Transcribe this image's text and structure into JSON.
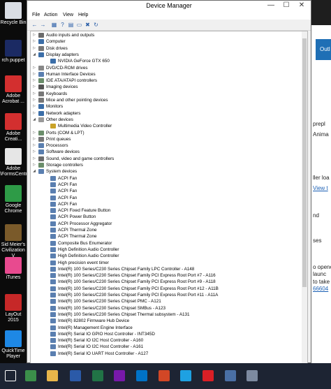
{
  "desktop": {
    "icons": [
      {
        "label": "Recycle Bin",
        "color": "#d9dde4"
      },
      {
        "label": "rch puppet",
        "color": "#1b2a63"
      },
      {
        "label": "Adobe Acrobat ...",
        "color": "#d32f2f"
      },
      {
        "label": "Adobe Creati...",
        "color": "#d32f2f"
      },
      {
        "label": "Adobe \\FormsCentral",
        "color": "#e6e6e6"
      },
      {
        "label": "Google Chrome",
        "color": "#2e9b47"
      },
      {
        "label": "Sid Meier's Civilization V",
        "color": "#7a5a2a"
      },
      {
        "label": "iTunes",
        "color": "#e84a8f"
      },
      {
        "label": "LayOut 2015",
        "color": "#c62828"
      },
      {
        "label": "QuickTime Player",
        "color": "#1e88e5"
      }
    ]
  },
  "background_window": {
    "text": [
      "Outl",
      "prepl",
      "Anima",
      "ller loa",
      "View t",
      "nd",
      "ses",
      "o opene",
      "launc",
      "to take",
      "66604"
    ]
  },
  "window": {
    "title": "Device Manager",
    "controls": {
      "minimize": "—",
      "maximize": "☐",
      "close": "✕"
    },
    "menu": [
      "File",
      "Action",
      "View",
      "Help"
    ],
    "toolbar_icons": [
      "back-icon",
      "forward-icon",
      "properties-icon",
      "help-icon",
      "driver-icon",
      "monitor-icon",
      "uninstall-icon",
      "scan-icon"
    ],
    "tree": [
      {
        "label": "Audio inputs and outputs",
        "level": 0,
        "expanded": false,
        "icon_color": "#6b6b6b"
      },
      {
        "label": "Computer",
        "level": 0,
        "expanded": false,
        "icon_color": "#3b6ea8"
      },
      {
        "label": "Disk drives",
        "level": 0,
        "expanded": false,
        "icon_color": "#777777"
      },
      {
        "label": "Display adapters",
        "level": 0,
        "expanded": true,
        "icon_color": "#3b6ea8"
      },
      {
        "label": "NVIDIA GeForce GTX 650",
        "level": 1,
        "expanded": null,
        "icon_color": "#3b6ea8"
      },
      {
        "label": "DVD/CD-ROM drives",
        "level": 0,
        "expanded": false,
        "icon_color": "#888888"
      },
      {
        "label": "Human Interface Devices",
        "level": 0,
        "expanded": false,
        "icon_color": "#5a7fb0"
      },
      {
        "label": "IDE ATA/ATAPI controllers",
        "level": 0,
        "expanded": false,
        "icon_color": "#6b8e6b"
      },
      {
        "label": "Imaging devices",
        "level": 0,
        "expanded": false,
        "icon_color": "#555555"
      },
      {
        "label": "Keyboards",
        "level": 0,
        "expanded": false,
        "icon_color": "#777777"
      },
      {
        "label": "Mice and other pointing devices",
        "level": 0,
        "expanded": false,
        "icon_color": "#777777"
      },
      {
        "label": "Monitors",
        "level": 0,
        "expanded": false,
        "icon_color": "#3b6ea8"
      },
      {
        "label": "Network adapters",
        "level": 0,
        "expanded": false,
        "icon_color": "#3b6ea8"
      },
      {
        "label": "Other devices",
        "level": 0,
        "expanded": true,
        "icon_color": "#999999"
      },
      {
        "label": "Multimedia Video Controller",
        "level": 1,
        "expanded": null,
        "icon_color": "#c9a227"
      },
      {
        "label": "Ports (COM & LPT)",
        "level": 0,
        "expanded": false,
        "icon_color": "#6b8e6b"
      },
      {
        "label": "Print queues",
        "level": 0,
        "expanded": false,
        "icon_color": "#777777"
      },
      {
        "label": "Processors",
        "level": 0,
        "expanded": false,
        "icon_color": "#5a7fb0"
      },
      {
        "label": "Software devices",
        "level": 0,
        "expanded": false,
        "icon_color": "#5a7fb0"
      },
      {
        "label": "Sound, video and game controllers",
        "level": 0,
        "expanded": false,
        "icon_color": "#6b6b6b"
      },
      {
        "label": "Storage controllers",
        "level": 0,
        "expanded": false,
        "icon_color": "#6b8e6b"
      },
      {
        "label": "System devices",
        "level": 0,
        "expanded": true,
        "icon_color": "#5a7fb0"
      },
      {
        "label": "ACPI Fan",
        "level": 1,
        "expanded": null,
        "icon_color": "#5a7fb0"
      },
      {
        "label": "ACPI Fan",
        "level": 1,
        "expanded": null,
        "icon_color": "#5a7fb0"
      },
      {
        "label": "ACPI Fan",
        "level": 1,
        "expanded": null,
        "icon_color": "#5a7fb0"
      },
      {
        "label": "ACPI Fan",
        "level": 1,
        "expanded": null,
        "icon_color": "#5a7fb0"
      },
      {
        "label": "ACPI Fan",
        "level": 1,
        "expanded": null,
        "icon_color": "#5a7fb0"
      },
      {
        "label": "ACPI Fixed Feature Button",
        "level": 1,
        "expanded": null,
        "icon_color": "#5a7fb0"
      },
      {
        "label": "ACPI Power Button",
        "level": 1,
        "expanded": null,
        "icon_color": "#5a7fb0"
      },
      {
        "label": "ACPI Processor Aggregator",
        "level": 1,
        "expanded": null,
        "icon_color": "#5a7fb0"
      },
      {
        "label": "ACPI Thermal Zone",
        "level": 1,
        "expanded": null,
        "icon_color": "#5a7fb0"
      },
      {
        "label": "ACPI Thermal Zone",
        "level": 1,
        "expanded": null,
        "icon_color": "#5a7fb0"
      },
      {
        "label": "Composite Bus Enumerator",
        "level": 1,
        "expanded": null,
        "icon_color": "#5a7fb0"
      },
      {
        "label": "High Definition Audio Controller",
        "level": 1,
        "expanded": null,
        "icon_color": "#5a7fb0"
      },
      {
        "label": "High Definition Audio Controller",
        "level": 1,
        "expanded": null,
        "icon_color": "#5a7fb0"
      },
      {
        "label": "High precision event timer",
        "level": 1,
        "expanded": null,
        "icon_color": "#5a7fb0"
      },
      {
        "label": "Intel(R) 100 Series/C230 Series Chipset Family LPC Controller - A148",
        "level": 1,
        "expanded": null,
        "icon_color": "#5a7fb0"
      },
      {
        "label": "Intel(R) 100 Series/C230 Series Chipset Family PCI Express Root Port #7 - A116",
        "level": 1,
        "expanded": null,
        "icon_color": "#5a7fb0"
      },
      {
        "label": "Intel(R) 100 Series/C230 Series Chipset Family PCI Express Root Port #9 - A118",
        "level": 1,
        "expanded": null,
        "icon_color": "#5a7fb0"
      },
      {
        "label": "Intel(R) 100 Series/C230 Series Chipset Family PCI Express Root Port #12 - A11B",
        "level": 1,
        "expanded": null,
        "icon_color": "#5a7fb0"
      },
      {
        "label": "Intel(R) 100 Series/C230 Series Chipset Family PCI Express Root Port #11 - A11A",
        "level": 1,
        "expanded": null,
        "icon_color": "#5a7fb0"
      },
      {
        "label": "Intel(R) 100 Series/C230 Series Chipset PMC - A121",
        "level": 1,
        "expanded": null,
        "icon_color": "#5a7fb0"
      },
      {
        "label": "Intel(R) 100 Series/C230 Series Chipset SMBus - A123",
        "level": 1,
        "expanded": null,
        "icon_color": "#5a7fb0"
      },
      {
        "label": "Intel(R) 100 Series/C230 Series Chipset Thermal subsystem - A131",
        "level": 1,
        "expanded": null,
        "icon_color": "#5a7fb0"
      },
      {
        "label": "Intel(R) 82802 Firmware Hub Device",
        "level": 1,
        "expanded": null,
        "icon_color": "#5a7fb0"
      },
      {
        "label": "Intel(R) Management Engine Interface",
        "level": 1,
        "expanded": null,
        "icon_color": "#5a7fb0"
      },
      {
        "label": "Intel(R) Serial IO GPIO Host Controller - INT345D",
        "level": 1,
        "expanded": null,
        "icon_color": "#5a7fb0"
      },
      {
        "label": "Intel(R) Serial IO I2C Host Controller - A160",
        "level": 1,
        "expanded": null,
        "icon_color": "#5a7fb0"
      },
      {
        "label": "Intel(R) Serial IO I2C Host Controller - A161",
        "level": 1,
        "expanded": null,
        "icon_color": "#5a7fb0"
      },
      {
        "label": "Intel(R) Serial IO UART Host Controller - A127",
        "level": 1,
        "expanded": null,
        "icon_color": "#5a7fb0"
      }
    ]
  },
  "taskbar": {
    "items": [
      {
        "name": "start-icon",
        "color": "#1d2433"
      },
      {
        "name": "chrome-icon",
        "color": "#3b8f4a"
      },
      {
        "name": "file-explorer-icon",
        "color": "#e8b54a"
      },
      {
        "name": "window-manager-icon",
        "color": "#2b5aa8"
      },
      {
        "name": "excel-icon",
        "color": "#217346"
      },
      {
        "name": "onenote-icon",
        "color": "#7719aa"
      },
      {
        "name": "outlook-icon",
        "color": "#0072c6"
      },
      {
        "name": "powerpoint-icon",
        "color": "#d24726"
      },
      {
        "name": "internet-explorer-icon",
        "color": "#1ea1e2"
      },
      {
        "name": "creative-cloud-icon",
        "color": "#da1f26"
      },
      {
        "name": "media-icon",
        "color": "#4a6fa5"
      },
      {
        "name": "device-manager-icon",
        "color": "#7d8aa0"
      }
    ]
  }
}
